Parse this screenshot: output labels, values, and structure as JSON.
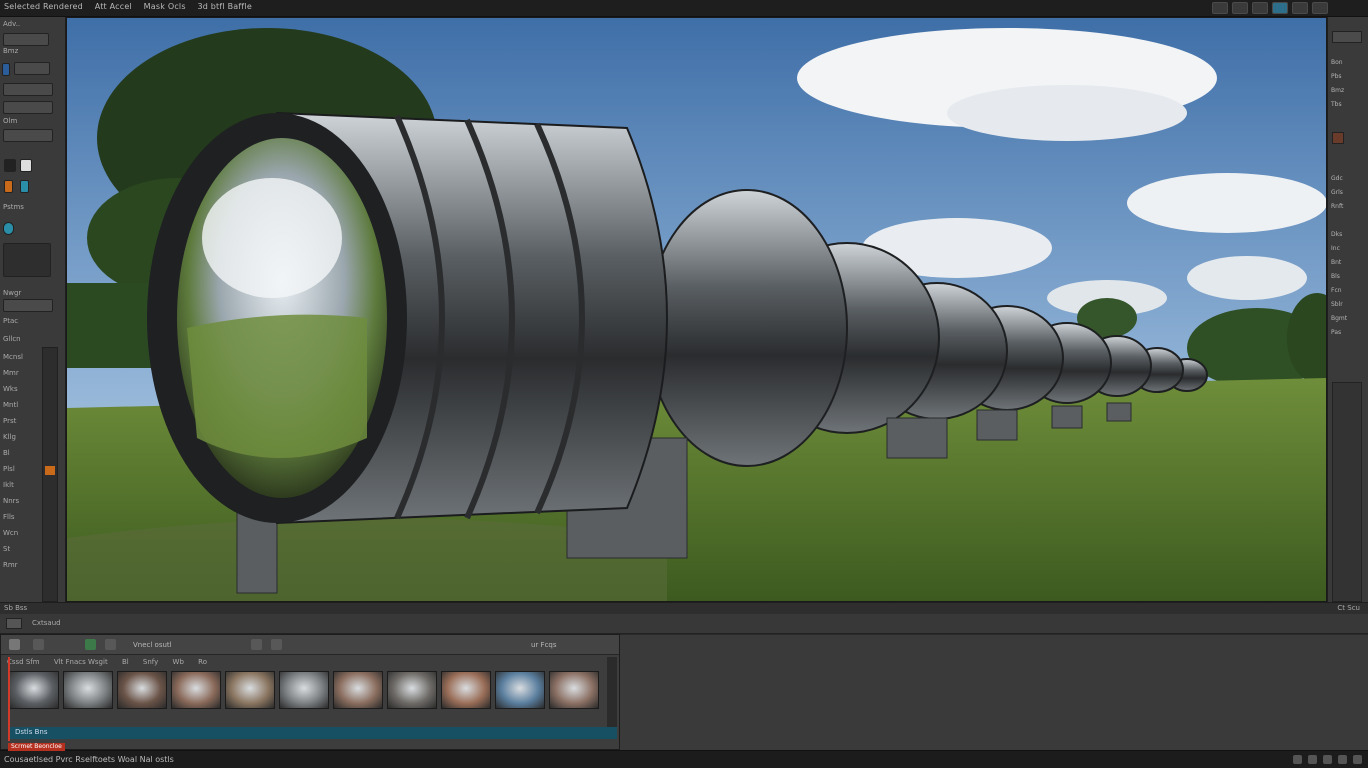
{
  "topbar": {
    "menu": [
      "Selected Rendered",
      "Att Accel",
      "Mask Ocls",
      "3d btfl Baffle"
    ]
  },
  "left_tools": {
    "rows": [
      "Adv..",
      "Bmz",
      "Olm",
      "Pstms",
      "Nwgr",
      "Ptac",
      "Gllcn",
      "Mcnsl",
      "Mmr",
      "Wks",
      "Mntl",
      "Prst",
      "Kllg",
      "Bl",
      "Plsl",
      "Iklt",
      "Nnrs",
      "Flls",
      "Wcn",
      "St",
      "Rmr"
    ]
  },
  "right_panel": {
    "labels": [
      "Bon",
      "Pbs",
      "Bmz",
      "Tbs",
      "Gdc",
      "Grls",
      "Rnft",
      "Dks",
      "Inc",
      "Bnt",
      "Bls",
      "Fcn",
      "Sblr",
      "Bgmt",
      "Pas"
    ]
  },
  "status_row": {
    "left": "Sb  Bss",
    "right": "Ct Scu"
  },
  "timeline": {
    "header_label": "Cxtsaud",
    "toolbar_text": "Vnecl osutl",
    "toolbar_right": "ur Fcqs",
    "labels": [
      "Cssd Sfm",
      "Vlt Fnacs Wsgit",
      "Bl",
      "Snfy",
      "Wb",
      "Ro"
    ],
    "track_label": "Dstls Bns",
    "thumb_count": 11
  },
  "bottom": {
    "tag": "Scrmet Beoncloe",
    "text": "Cousaetlsed  Pvrc Rselftoets Woal  Nal  ostls"
  },
  "colors": {
    "accent_blue": "#2a5d9a",
    "accent_orange": "#c96a1a",
    "playhead": "#d43a2a",
    "track": "#174f63"
  }
}
